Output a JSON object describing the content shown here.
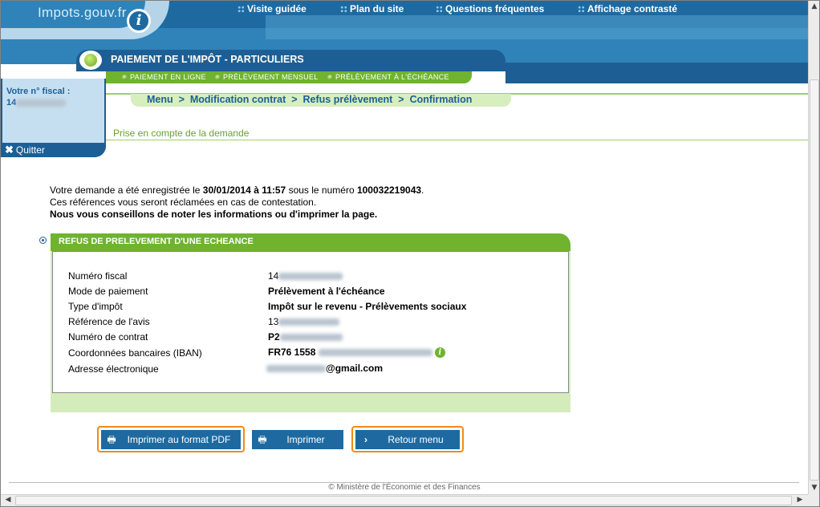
{
  "header": {
    "logo_text": "Impots.gouv.fr",
    "logo_icon": "i",
    "links": [
      "Visite guidée",
      "Plan du site",
      "Questions fréquentes",
      "Affichage contrasté"
    ]
  },
  "title": "PAIEMENT DE L'IMPÔT - PARTICULIERS",
  "subnav": [
    "PAIEMENT EN LIGNE",
    "PRÉLÈVEMENT MENSUEL",
    "PRÉLÈVEMENT À L'ÉCHÉANCE"
  ],
  "sidebar": {
    "label": "Votre n° fiscal :",
    "number_prefix": "14",
    "quit": "Quitter"
  },
  "breadcrumb": [
    "Menu",
    "Modification contrat",
    "Refus prélèvement",
    "Confirmation"
  ],
  "page_subtitle": "Prise en compte de la demande",
  "message": {
    "line1_a": "Votre demande a été enregistrée le ",
    "line1_date": "30/01/2014 à 11:57",
    "line1_b": " sous le numéro ",
    "line1_number": "100032219043",
    "line1_c": ".",
    "line2": "Ces références vous seront réclamées en cas de contestation.",
    "line3": "Nous vous conseillons de noter les informations ou d'imprimer la page."
  },
  "section": {
    "title": "REFUS DE PRELEVEMENT D'UNE ECHEANCE",
    "rows": [
      {
        "label": "Numéro fiscal",
        "value": "14"
      },
      {
        "label": "Mode de paiement",
        "value": "Prélèvement à l'échéance"
      },
      {
        "label": "Type d'impôt",
        "value": "Impôt sur le revenu - Prélèvements sociaux"
      },
      {
        "label": "Référence de l'avis",
        "value": "13"
      },
      {
        "label": "Numéro de contrat",
        "value": "P2"
      },
      {
        "label": "Coordonnées bancaires (IBAN)",
        "value": "FR76 1558"
      },
      {
        "label": "Adresse électronique",
        "value": "@gmail.com"
      }
    ]
  },
  "buttons": {
    "pdf": "Imprimer au format PDF",
    "print": "Imprimer",
    "back": "Retour menu"
  },
  "footer": "© Ministère de l'Économie et des Finances",
  "colors": {
    "primary_blue": "#1e6aa0",
    "green": "#6fb32e",
    "highlight": "#f28a1a"
  }
}
